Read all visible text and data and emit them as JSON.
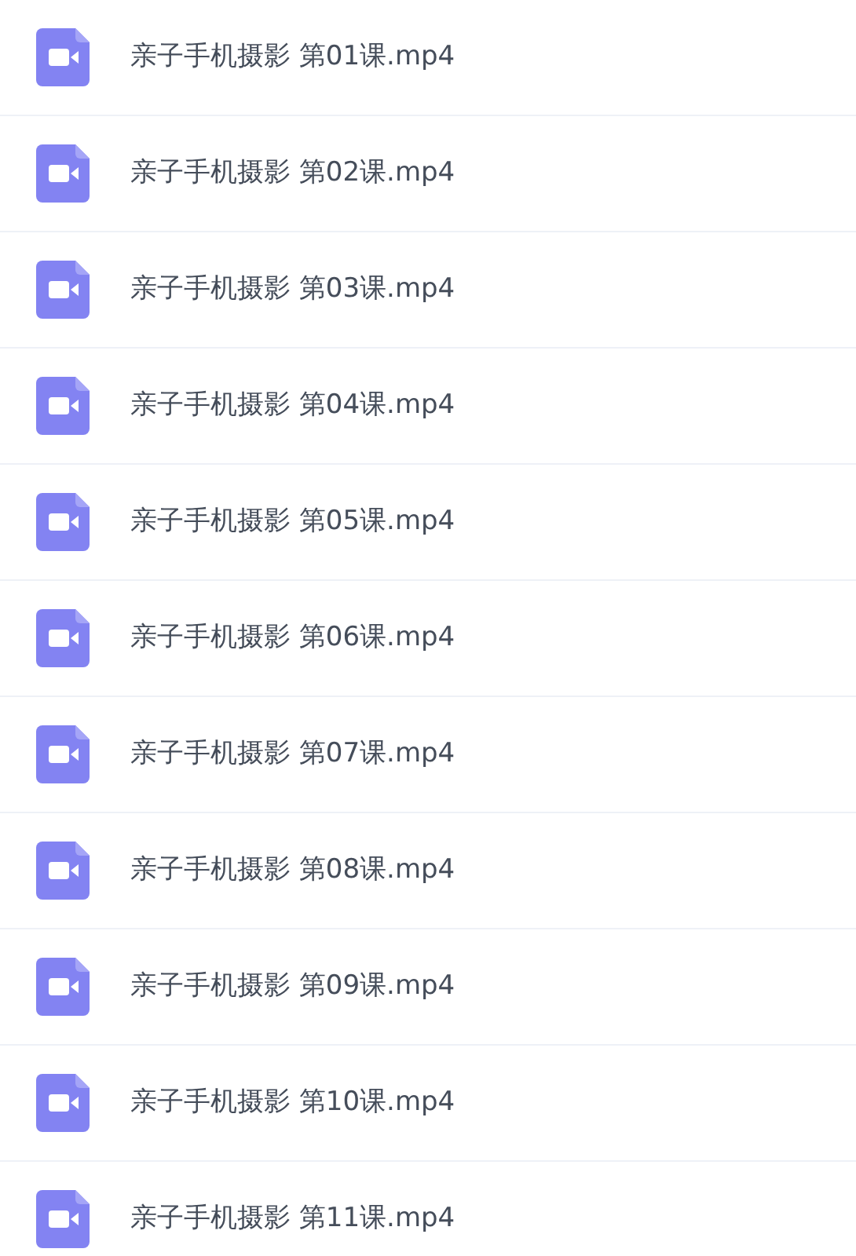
{
  "files": [
    {
      "name": "亲子手机摄影 第01课.mp4",
      "kind": "video"
    },
    {
      "name": "亲子手机摄影 第02课.mp4",
      "kind": "video"
    },
    {
      "name": "亲子手机摄影 第03课.mp4",
      "kind": "video"
    },
    {
      "name": "亲子手机摄影 第04课.mp4",
      "kind": "video"
    },
    {
      "name": "亲子手机摄影 第05课.mp4",
      "kind": "video"
    },
    {
      "name": "亲子手机摄影 第06课.mp4",
      "kind": "video"
    },
    {
      "name": "亲子手机摄影 第07课.mp4",
      "kind": "video"
    },
    {
      "name": "亲子手机摄影 第08课.mp4",
      "kind": "video"
    },
    {
      "name": "亲子手机摄影 第09课.mp4",
      "kind": "video"
    },
    {
      "name": "亲子手机摄影 第10课.mp4",
      "kind": "video"
    },
    {
      "name": "亲子手机摄影 第11课.mp4",
      "kind": "video"
    }
  ]
}
